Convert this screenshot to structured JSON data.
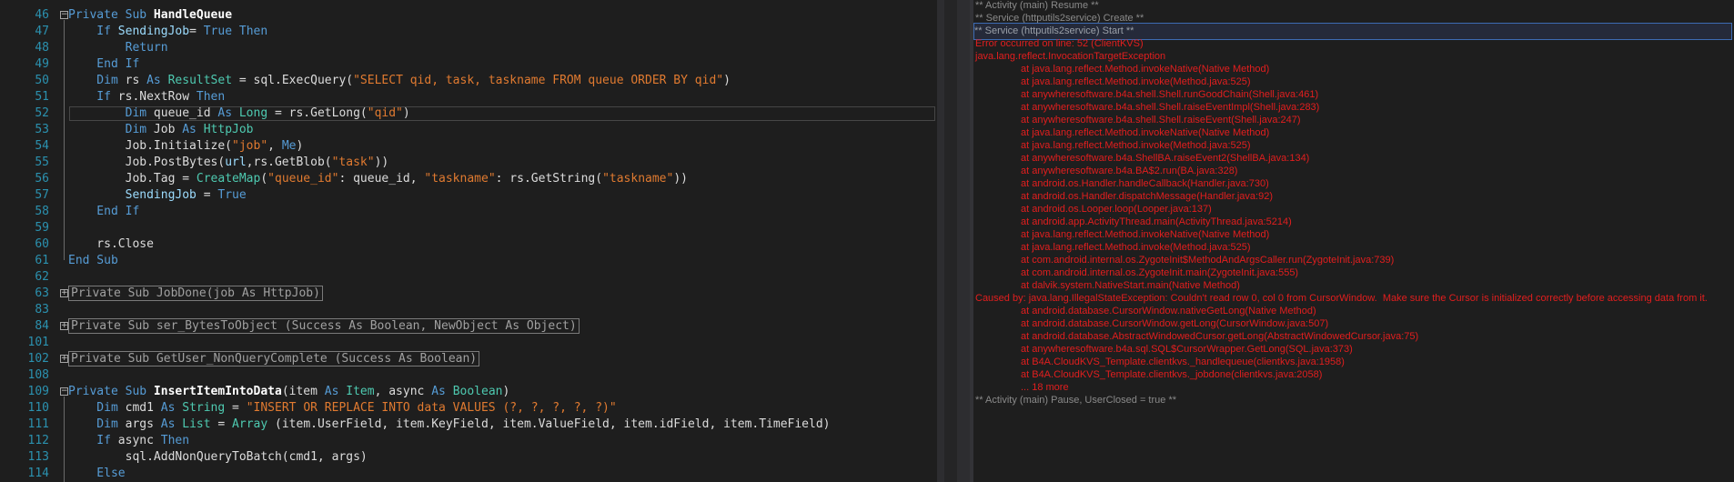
{
  "editor": {
    "lines": [
      {
        "num": "46",
        "tokens": [
          [
            "kw",
            "Private Sub "
          ],
          [
            "bold",
            "HandleQueue"
          ]
        ],
        "fold": "open"
      },
      {
        "num": "47",
        "tokens": [
          [
            "kw",
            "    If "
          ],
          [
            "hl",
            "SendingJob"
          ],
          [
            "",
            "="
          ],
          [
            "kw",
            " True Then"
          ]
        ]
      },
      {
        "num": "48",
        "tokens": [
          [
            "kw",
            "        Return"
          ]
        ]
      },
      {
        "num": "49",
        "tokens": [
          [
            "kw",
            "    End If"
          ]
        ]
      },
      {
        "num": "50",
        "tokens": [
          [
            "kw",
            "    Dim "
          ],
          [
            "",
            "rs "
          ],
          [
            "kw",
            "As "
          ],
          [
            "ty",
            "ResultSet"
          ],
          [
            "",
            " = sql.ExecQuery("
          ],
          [
            "st2",
            "\"SELECT qid, task, taskname FROM queue ORDER BY qid\""
          ],
          [
            "",
            ")"
          ]
        ]
      },
      {
        "num": "51",
        "tokens": [
          [
            "kw",
            "    If "
          ],
          [
            "",
            "rs.NextRow "
          ],
          [
            "kw",
            "Then"
          ]
        ]
      },
      {
        "num": "52",
        "tokens": [
          [
            "kw",
            "        Dim "
          ],
          [
            "",
            "queue_id "
          ],
          [
            "kw",
            "As "
          ],
          [
            "ty",
            "Long"
          ],
          [
            "",
            " = rs.GetLong("
          ],
          [
            "st2",
            "\"qid\""
          ],
          [
            "",
            ")"
          ]
        ],
        "current": true
      },
      {
        "num": "53",
        "tokens": [
          [
            "kw",
            "        Dim "
          ],
          [
            "",
            "Job "
          ],
          [
            "kw",
            "As "
          ],
          [
            "ty",
            "HttpJob"
          ]
        ]
      },
      {
        "num": "54",
        "tokens": [
          [
            "",
            "        Job.Initialize("
          ],
          [
            "st2",
            "\"job\""
          ],
          [
            "",
            ", "
          ],
          [
            "kw",
            "Me"
          ],
          [
            "",
            ")"
          ]
        ]
      },
      {
        "num": "55",
        "tokens": [
          [
            "",
            "        Job.PostBytes("
          ],
          [
            "hl",
            "url"
          ],
          [
            "",
            ",rs.GetBlob("
          ],
          [
            "st2",
            "\"task\""
          ],
          [
            "",
            "))"
          ]
        ]
      },
      {
        "num": "56",
        "tokens": [
          [
            "",
            "        Job.Tag = "
          ],
          [
            "ty",
            "CreateMap"
          ],
          [
            "",
            "("
          ],
          [
            "st2",
            "\"queue_id\""
          ],
          [
            "",
            ": queue_id, "
          ],
          [
            "st2",
            "\"taskname\""
          ],
          [
            "",
            ": rs.GetString("
          ],
          [
            "st2",
            "\"taskname\""
          ],
          [
            "",
            "))"
          ]
        ]
      },
      {
        "num": "57",
        "tokens": [
          [
            "hl",
            "        SendingJob"
          ],
          [
            "",
            " = "
          ],
          [
            "kw",
            "True"
          ]
        ]
      },
      {
        "num": "58",
        "tokens": [
          [
            "kw",
            "    End If"
          ]
        ]
      },
      {
        "num": "59",
        "tokens": []
      },
      {
        "num": "60",
        "tokens": [
          [
            "",
            "    rs.Close"
          ]
        ]
      },
      {
        "num": "61",
        "tokens": [
          [
            "kw",
            "End Sub"
          ]
        ]
      },
      {
        "num": "62",
        "tokens": []
      },
      {
        "num": "63",
        "tokens": [
          [
            "collapsed",
            "Private Sub JobDone(job As HttpJob)"
          ]
        ],
        "fold": "closed"
      },
      {
        "num": "83",
        "tokens": []
      },
      {
        "num": "84",
        "tokens": [
          [
            "collapsed",
            "Private Sub ser_BytesToObject (Success As Boolean, NewObject As Object)"
          ]
        ],
        "fold": "closed"
      },
      {
        "num": "101",
        "tokens": []
      },
      {
        "num": "102",
        "tokens": [
          [
            "collapsed",
            "Private Sub GetUser_NonQueryComplete (Success As Boolean)"
          ]
        ],
        "fold": "closed"
      },
      {
        "num": "108",
        "tokens": []
      },
      {
        "num": "109",
        "tokens": [
          [
            "kw",
            "Private Sub "
          ],
          [
            "bold",
            "InsertItemIntoData"
          ],
          [
            "",
            "(item "
          ],
          [
            "kw",
            "As "
          ],
          [
            "ty",
            "Item"
          ],
          [
            "",
            ", async "
          ],
          [
            "kw",
            "As "
          ],
          [
            "ty",
            "Boolean"
          ],
          [
            "",
            ")"
          ]
        ],
        "fold": "open"
      },
      {
        "num": "110",
        "tokens": [
          [
            "kw",
            "    Dim "
          ],
          [
            "",
            "cmd1 "
          ],
          [
            "kw",
            "As "
          ],
          [
            "ty",
            "String"
          ],
          [
            "",
            " = "
          ],
          [
            "st2",
            "\"INSERT OR REPLACE INTO data VALUES (?, ?, ?, ?, ?)\""
          ]
        ]
      },
      {
        "num": "111",
        "tokens": [
          [
            "kw",
            "    Dim "
          ],
          [
            "",
            "args "
          ],
          [
            "kw",
            "As "
          ],
          [
            "ty",
            "List"
          ],
          [
            "",
            " = "
          ],
          [
            "ty",
            "Array"
          ],
          [
            "",
            " (item.UserField, item.KeyField, item.ValueField, item.idField, item.TimeField)"
          ]
        ]
      },
      {
        "num": "112",
        "tokens": [
          [
            "kw",
            "    If "
          ],
          [
            "",
            "async "
          ],
          [
            "kw",
            "Then"
          ]
        ]
      },
      {
        "num": "113",
        "tokens": [
          [
            "",
            "        sql.AddNonQueryToBatch(cmd1, args)"
          ]
        ]
      },
      {
        "num": "114",
        "tokens": [
          [
            "kw",
            "    Else"
          ]
        ]
      }
    ]
  },
  "logs": [
    {
      "text": "** Activity (main) Resume **",
      "style": "gray",
      "indent": false
    },
    {
      "text": "** Service (httputils2service) Create **",
      "style": "gray",
      "indent": false
    },
    {
      "text": "** Service (httputils2service) Start **",
      "style": "sel",
      "indent": false
    },
    {
      "text": "Error occurred on line: 52 (ClientKVS)",
      "style": "red",
      "indent": false
    },
    {
      "text": "java.lang.reflect.InvocationTargetException",
      "style": "red",
      "indent": false
    },
    {
      "text": "at java.lang.reflect.Method.invokeNative(Native Method)",
      "style": "red",
      "indent": true
    },
    {
      "text": "at java.lang.reflect.Method.invoke(Method.java:525)",
      "style": "red",
      "indent": true
    },
    {
      "text": "at anywheresoftware.b4a.shell.Shell.runGoodChain(Shell.java:461)",
      "style": "red",
      "indent": true
    },
    {
      "text": "at anywheresoftware.b4a.shell.Shell.raiseEventImpl(Shell.java:283)",
      "style": "red",
      "indent": true
    },
    {
      "text": "at anywheresoftware.b4a.shell.Shell.raiseEvent(Shell.java:247)",
      "style": "red",
      "indent": true
    },
    {
      "text": "at java.lang.reflect.Method.invokeNative(Native Method)",
      "style": "red",
      "indent": true
    },
    {
      "text": "at java.lang.reflect.Method.invoke(Method.java:525)",
      "style": "red",
      "indent": true
    },
    {
      "text": "at anywheresoftware.b4a.ShellBA.raiseEvent2(ShellBA.java:134)",
      "style": "red",
      "indent": true
    },
    {
      "text": "at anywheresoftware.b4a.BA$2.run(BA.java:328)",
      "style": "red",
      "indent": true
    },
    {
      "text": "at android.os.Handler.handleCallback(Handler.java:730)",
      "style": "red",
      "indent": true
    },
    {
      "text": "at android.os.Handler.dispatchMessage(Handler.java:92)",
      "style": "red",
      "indent": true
    },
    {
      "text": "at android.os.Looper.loop(Looper.java:137)",
      "style": "red",
      "indent": true
    },
    {
      "text": "at android.app.ActivityThread.main(ActivityThread.java:5214)",
      "style": "red",
      "indent": true
    },
    {
      "text": "at java.lang.reflect.Method.invokeNative(Native Method)",
      "style": "red",
      "indent": true
    },
    {
      "text": "at java.lang.reflect.Method.invoke(Method.java:525)",
      "style": "red",
      "indent": true
    },
    {
      "text": "at com.android.internal.os.ZygoteInit$MethodAndArgsCaller.run(ZygoteInit.java:739)",
      "style": "red",
      "indent": true
    },
    {
      "text": "at com.android.internal.os.ZygoteInit.main(ZygoteInit.java:555)",
      "style": "red",
      "indent": true
    },
    {
      "text": "at dalvik.system.NativeStart.main(Native Method)",
      "style": "red",
      "indent": true
    },
    {
      "text": "Caused by: java.lang.IllegalStateException: Couldn't read row 0, col 0 from CursorWindow.  Make sure the Cursor is initialized correctly before accessing data from it.",
      "style": "red",
      "indent": false
    },
    {
      "text": "at android.database.CursorWindow.nativeGetLong(Native Method)",
      "style": "red",
      "indent": true
    },
    {
      "text": "at android.database.CursorWindow.getLong(CursorWindow.java:507)",
      "style": "red",
      "indent": true
    },
    {
      "text": "at android.database.AbstractWindowedCursor.getLong(AbstractWindowedCursor.java:75)",
      "style": "red",
      "indent": true
    },
    {
      "text": "at anywheresoftware.b4a.sql.SQL$CursorWrapper.GetLong(SQL.java:373)",
      "style": "red",
      "indent": true
    },
    {
      "text": "at B4A.CloudKVS_Template.clientkvs._handlequeue(clientkvs.java:1958)",
      "style": "red",
      "indent": true
    },
    {
      "text": "at B4A.CloudKVS_Template.clientkvs._jobdone(clientkvs.java:2058)",
      "style": "red",
      "indent": true
    },
    {
      "text": "... 18 more",
      "style": "red",
      "indent": true
    },
    {
      "text": "** Activity (main) Pause, UserClosed = true **",
      "style": "gray",
      "indent": false
    }
  ]
}
